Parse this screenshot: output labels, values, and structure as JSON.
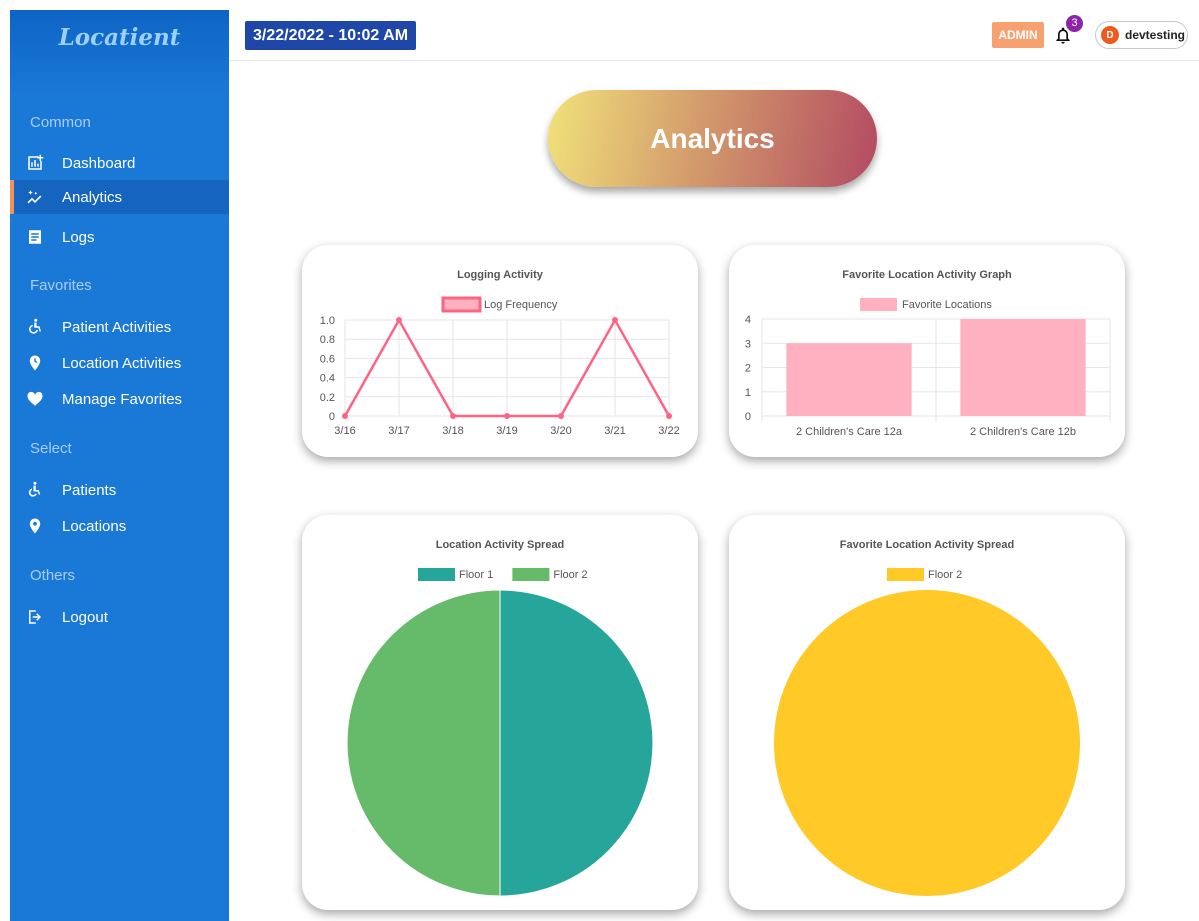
{
  "app": {
    "name": "Locatient"
  },
  "header": {
    "datetime": "3/22/2022 - 10:02 AM",
    "role_badge": "ADMIN",
    "notifications_count": "3",
    "user": {
      "initial": "D",
      "name": "devtesting"
    }
  },
  "sidebar": {
    "sections": [
      {
        "title": "Common",
        "items": [
          {
            "label": "Dashboard",
            "icon": "dashboard-icon"
          },
          {
            "label": "Analytics",
            "icon": "analytics-icon",
            "active": true
          },
          {
            "label": "Logs",
            "icon": "logs-icon"
          }
        ]
      },
      {
        "title": "Favorites",
        "items": [
          {
            "label": "Patient Activities",
            "icon": "wheelchair-icon"
          },
          {
            "label": "Location Activities",
            "icon": "location-pin-icon"
          },
          {
            "label": "Manage Favorites",
            "icon": "heart-icon"
          }
        ]
      },
      {
        "title": "Select",
        "items": [
          {
            "label": "Patients",
            "icon": "wheelchair-person-icon"
          },
          {
            "label": "Locations",
            "icon": "map-marker-icon"
          }
        ]
      },
      {
        "title": "Others",
        "items": [
          {
            "label": "Logout",
            "icon": "logout-icon"
          }
        ]
      }
    ]
  },
  "page": {
    "heading": "Analytics"
  },
  "colors": {
    "sidebar": "#1a78d6",
    "active_indicator": "#f0935a",
    "line": "#ff6384",
    "bar_fill": "#ffb1c1",
    "floor1": "#26a69a",
    "floor2_green": "#66bb6a",
    "floor2_yellow": "#ffca28"
  },
  "chart_data": [
    {
      "type": "line",
      "title": "Logging Activity",
      "series": [
        {
          "name": "Log Frequency",
          "values": [
            0,
            1,
            0,
            0,
            0,
            1,
            0
          ]
        }
      ],
      "categories": [
        "3/16",
        "3/17",
        "3/18",
        "3/19",
        "3/20",
        "3/21",
        "3/22"
      ],
      "yticks": [
        "0",
        "0.2",
        "0.4",
        "0.6",
        "0.8",
        "1.0"
      ],
      "ylim": [
        0,
        1
      ],
      "legend": "top",
      "grid": true
    },
    {
      "type": "bar",
      "title": "Favorite Location Activity Graph",
      "series": [
        {
          "name": "Favorite Locations",
          "values": [
            3,
            4
          ]
        }
      ],
      "categories": [
        "2 Children's Care 12a",
        "2 Children's Care 12b"
      ],
      "yticks": [
        "0",
        "1",
        "2",
        "3",
        "4"
      ],
      "ylim": [
        0,
        4
      ],
      "legend": "top",
      "grid": true
    },
    {
      "type": "pie",
      "title": "Location Activity Spread",
      "labels": [
        "Floor 1",
        "Floor 2"
      ],
      "values": [
        1,
        1
      ],
      "colors": [
        "#26a69a",
        "#66bb6a"
      ],
      "legend": "top"
    },
    {
      "type": "pie",
      "title": "Favorite Location Activity Spread",
      "labels": [
        "Floor 2"
      ],
      "values": [
        1
      ],
      "colors": [
        "#ffca28"
      ],
      "legend": "top"
    }
  ]
}
